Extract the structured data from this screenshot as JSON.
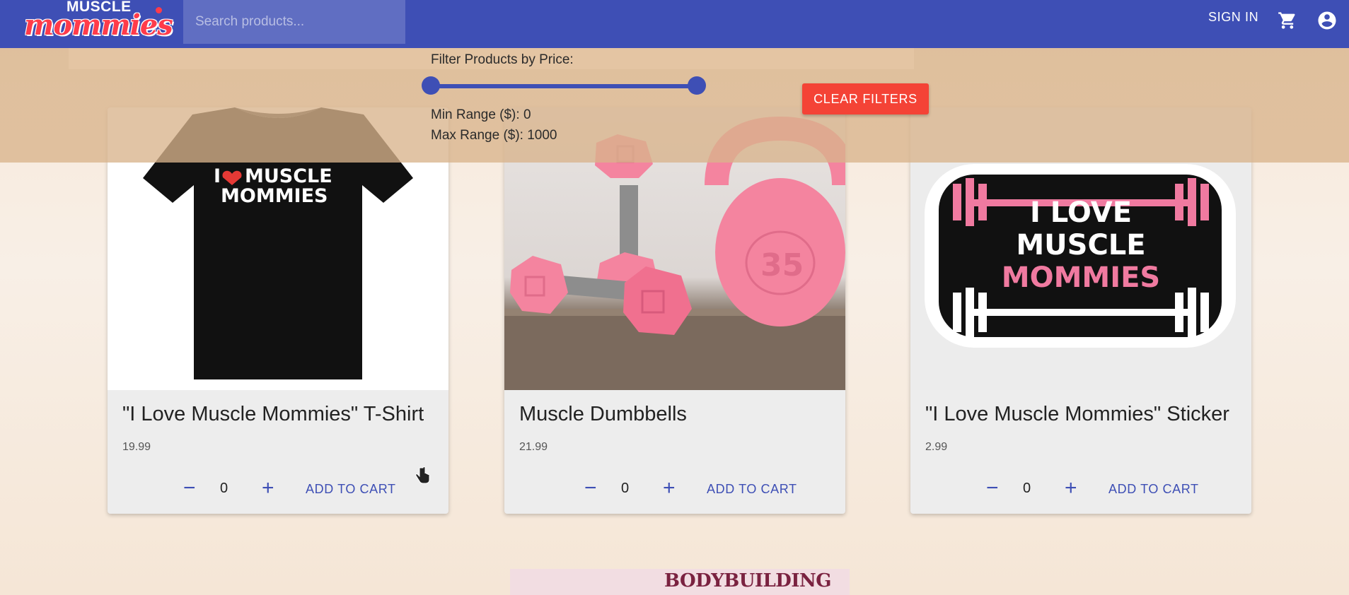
{
  "header": {
    "logo_top": "MUSCLE",
    "logo_main": "mommies",
    "search_placeholder": "Search products...",
    "signin_label": "SIGN IN",
    "cart_icon": "shopping-cart-icon",
    "account_icon": "account-circle-icon"
  },
  "filter": {
    "title": "Filter Products by Price:",
    "min_label": "Min Range ($): 0",
    "max_label": "Max Range ($): 1000",
    "slider_min": 0,
    "slider_max": 1000,
    "clear_label": "CLEAR FILTERS"
  },
  "products": [
    {
      "title": "\"I Love Muscle Mommies\" T-Shirt",
      "price": "19.99",
      "qty": "0",
      "add_label": "ADD TO CART",
      "image": "black-tshirt"
    },
    {
      "title": "Muscle Dumbbells",
      "price": "21.99",
      "qty": "0",
      "add_label": "ADD TO CART",
      "image": "pink-dumbbells-kettlebell"
    },
    {
      "title": "\"I Love Muscle Mommies\" Sticker",
      "price": "2.99",
      "qty": "0",
      "add_label": "ADD TO CART",
      "image": "barbell-sticker"
    }
  ],
  "images": {
    "tshirt_text_1": "I",
    "tshirt_text_2": "MUSCLE",
    "tshirt_text_3": "MOMMIES",
    "kettlebell_text": "35",
    "sticker_line_1": "I LOVE",
    "sticker_line_2": "MUSCLE",
    "sticker_line_3": "MOMMIES",
    "bottom_partial_text": "BODYBUILDING"
  },
  "colors": {
    "primary": "#3e4fb5",
    "danger": "#f44336",
    "logo_red": "#ff3b4a",
    "pink": "#f07aa0"
  }
}
